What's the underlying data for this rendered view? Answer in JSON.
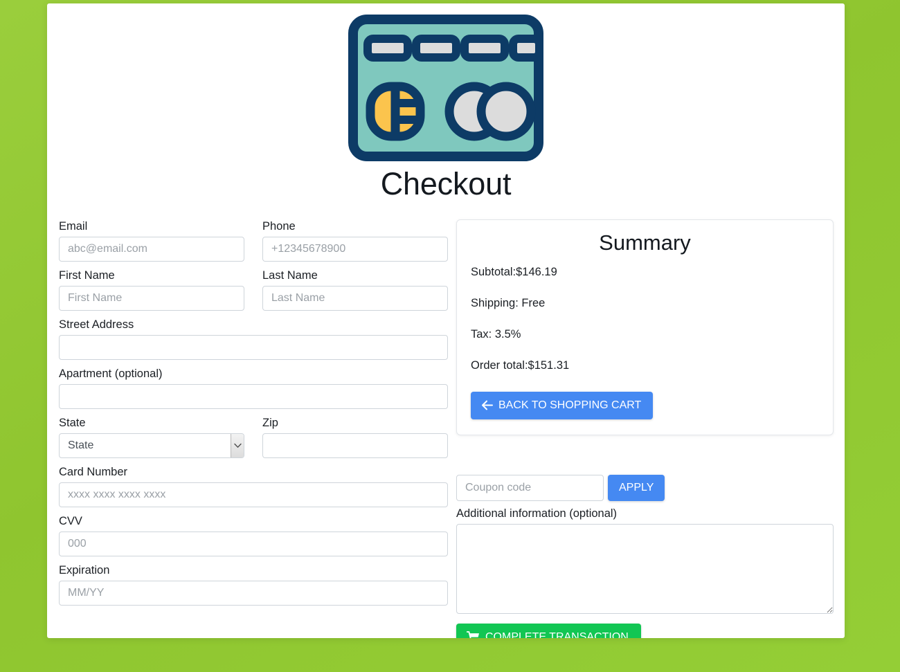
{
  "page": {
    "title": "Checkout",
    "card_icon": "credit-card-icon",
    "background_color": "#93CC33",
    "accent_blue": "#4589f2",
    "accent_green": "#12c653",
    "card_icon_colors": {
      "teal": "#7FC8BE",
      "navy": "#0D3B66",
      "yellow": "#FBC44D",
      "grey": "#DCDCDC"
    }
  },
  "form": {
    "fields": [
      {
        "label": "Email",
        "placeholder": "abc@email.com",
        "value": "",
        "name": "email-field",
        "type": "text"
      },
      {
        "label": "Phone",
        "placeholder": "+12345678900",
        "value": "",
        "name": "phone-field",
        "type": "text"
      },
      {
        "label": "First Name",
        "placeholder": "First Name",
        "value": "",
        "name": "first-name-field",
        "type": "text"
      },
      {
        "label": "Last Name",
        "placeholder": "Last Name",
        "value": "",
        "name": "last-name-field",
        "type": "text"
      },
      {
        "label": "Street Address",
        "placeholder": "",
        "value": "",
        "name": "street-address-field",
        "type": "text"
      },
      {
        "label": "Apartment (optional)",
        "placeholder": "",
        "value": "",
        "name": "apartment-field",
        "type": "text"
      },
      {
        "label": "State",
        "placeholder": "",
        "value": "State",
        "name": "state-select",
        "type": "select"
      },
      {
        "label": "Zip",
        "placeholder": "",
        "value": "",
        "name": "zip-field",
        "type": "text"
      },
      {
        "label": "Card Number",
        "placeholder": "xxxx xxxx xxxx xxxx",
        "value": "",
        "name": "card-number-field",
        "type": "text"
      },
      {
        "label": "CVV",
        "placeholder": "000",
        "value": "",
        "name": "cvv-field",
        "type": "text"
      },
      {
        "label": "Expiration",
        "placeholder": "MM/YY",
        "value": "",
        "name": "expiration-field",
        "type": "text"
      }
    ],
    "state_select_value": "State"
  },
  "summary": {
    "title": "Summary",
    "lines": [
      "Subtotal:$146.19",
      "Shipping: Free",
      "Tax: 3.5%",
      "Order total:$151.31"
    ],
    "subtotal_label": "Subtotal:",
    "subtotal_value": "$146.19",
    "shipping_label": "Shipping:",
    "shipping_value": "Free",
    "tax_label": "Tax:",
    "tax_value": "3.5%",
    "order_total_label": "Order total:",
    "order_total_value": "$151.31",
    "back_button_label": "BACK TO SHOPPING CART",
    "back_button_icon": "arrow-left-icon"
  },
  "coupon": {
    "placeholder": "Coupon code",
    "value": "",
    "apply_label": "APPLY"
  },
  "additional": {
    "label": "Additional information (optional)",
    "placeholder": "",
    "value": ""
  },
  "actions": {
    "complete_label": "COMPLETE TRANSACTION",
    "complete_icon": "shopping-cart-icon"
  }
}
